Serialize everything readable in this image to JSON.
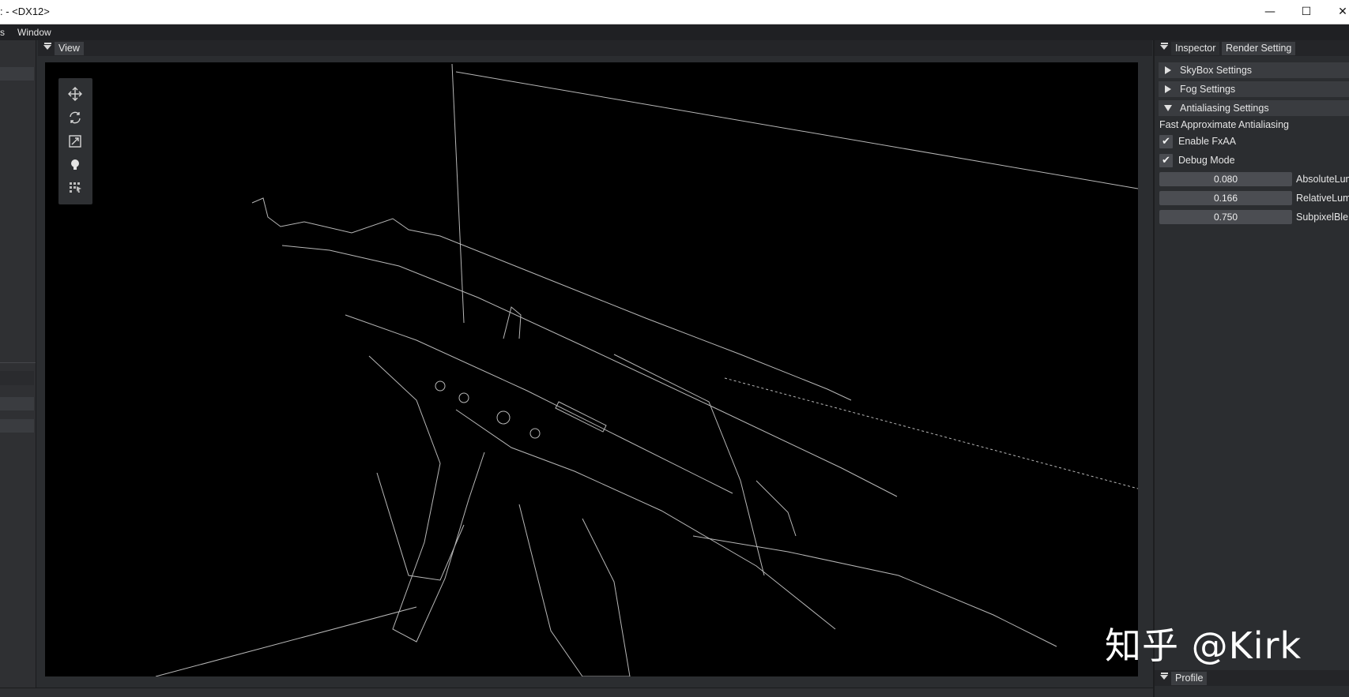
{
  "window": {
    "title": ": - <DX12>",
    "minimize_glyph": "—",
    "maximize_glyph": "☐",
    "close_glyph": "✕"
  },
  "menubar": {
    "items": [
      "s",
      "Window"
    ]
  },
  "view_panel": {
    "tab_label": "View",
    "gizmo_tools": [
      "move-icon",
      "rotate-icon",
      "scale-icon",
      "light-icon",
      "grid-icon"
    ]
  },
  "right_panel": {
    "tabs": [
      "Inspector",
      "Render Setting"
    ],
    "active_tab": "Render Setting",
    "sections": [
      {
        "label": "SkyBox Settings",
        "expanded": false
      },
      {
        "label": "Fog Settings",
        "expanded": false
      },
      {
        "label": "Antialiasing Settings",
        "expanded": true
      }
    ],
    "antialiasing": {
      "heading": "Fast Approximate Antialiasing",
      "checkboxes": [
        {
          "label": "Enable FxAA",
          "checked": true
        },
        {
          "label": "Debug Mode",
          "checked": true
        }
      ],
      "sliders": [
        {
          "value": "0.080",
          "label": "AbsoluteLum"
        },
        {
          "value": "0.166",
          "label": "RelativeLum"
        },
        {
          "value": "0.750",
          "label": "SubpixelBle"
        }
      ]
    },
    "profile_tab": "Profile"
  },
  "watermark": "知乎 @Kirk",
  "colors": {
    "panel_bg": "#2b2d30",
    "viewport_bg": "#000000",
    "widget_bg": "#4b4d52",
    "section_bg": "#3a3c40"
  }
}
